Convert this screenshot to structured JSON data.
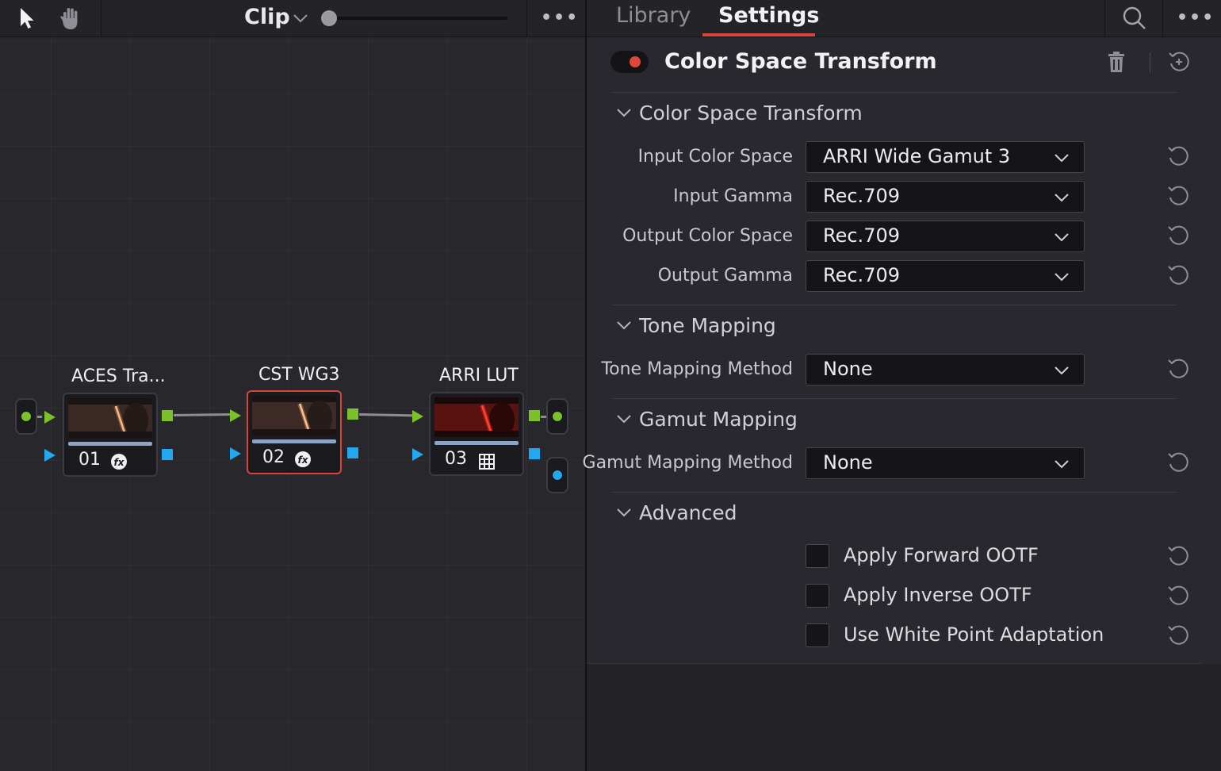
{
  "left_toolbar": {
    "pointer_tool": "pointer-icon",
    "hand_tool": "hand-icon",
    "mode_label": "Clip",
    "zoom_level": 0.04,
    "more_label": "•••"
  },
  "nodes": [
    {
      "title": "ACES Tra...",
      "number": "01",
      "kind": "fx-icon",
      "selected": false
    },
    {
      "title": "CST WG3",
      "number": "02",
      "kind": "fx-icon",
      "selected": true
    },
    {
      "title": "ARRI LUT",
      "number": "03",
      "kind": "lut-grid-icon",
      "selected": false
    }
  ],
  "right_toolbar": {
    "tabs": [
      {
        "label": "Library",
        "active": false
      },
      {
        "label": "Settings",
        "active": true
      }
    ],
    "search_icon": "search-icon",
    "more_label": "•••"
  },
  "effect": {
    "enabled": true,
    "title": "Color Space Transform"
  },
  "sections": {
    "cst": {
      "title": "Color Space Transform",
      "params": [
        {
          "label": "Input Color Space",
          "value": "ARRI Wide Gamut 3"
        },
        {
          "label": "Input Gamma",
          "value": "Rec.709"
        },
        {
          "label": "Output Color Space",
          "value": "Rec.709"
        },
        {
          "label": "Output Gamma",
          "value": "Rec.709"
        }
      ]
    },
    "tone": {
      "title": "Tone Mapping",
      "params": [
        {
          "label": "Tone Mapping Method",
          "value": "None"
        }
      ]
    },
    "gamut": {
      "title": "Gamut Mapping",
      "params": [
        {
          "label": "Gamut Mapping Method",
          "value": "None"
        }
      ]
    },
    "advanced": {
      "title": "Advanced",
      "checkboxes": [
        {
          "label": "Apply Forward OOTF",
          "checked": false
        },
        {
          "label": "Apply Inverse OOTF",
          "checked": false
        },
        {
          "label": "Use White Point Adaptation",
          "checked": false
        }
      ]
    }
  },
  "colors": {
    "accent_red": "#d8463a",
    "port_green": "#7cc12a",
    "port_blue": "#22a8ee"
  }
}
